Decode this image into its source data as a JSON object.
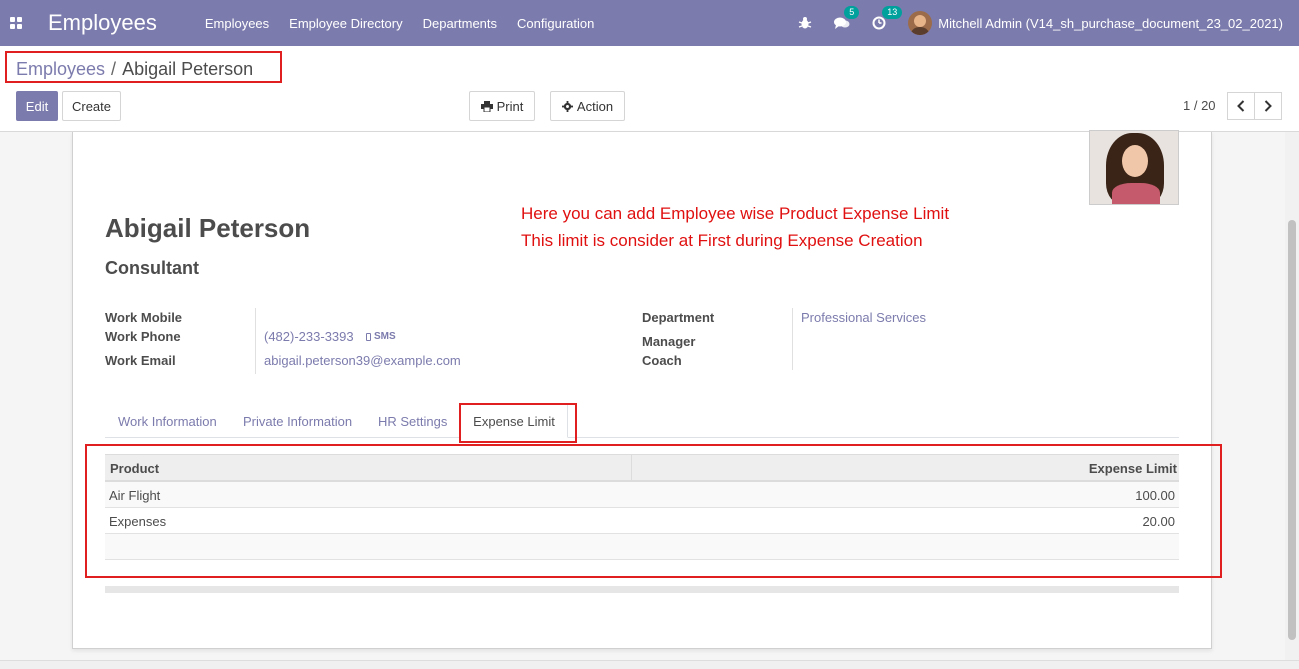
{
  "navbar": {
    "app_title": "Employees",
    "menu": [
      "Employees",
      "Employee Directory",
      "Departments",
      "Configuration"
    ],
    "messages_count": "5",
    "activities_count": "13",
    "user_name": "Mitchell Admin (V14_sh_purchase_document_23_02_2021)"
  },
  "breadcrumb": {
    "parent": "Employees",
    "separator": "/",
    "current": "Abigail Peterson"
  },
  "toolbar": {
    "edit_label": "Edit",
    "create_label": "Create",
    "print_label": "Print",
    "action_label": "Action"
  },
  "pager": {
    "value": "1 / 20"
  },
  "employee": {
    "name": "Abigail Peterson",
    "job_title": "Consultant"
  },
  "annotation": {
    "line1": "Here you can add Employee wise Product Expense Limit",
    "line2": "This limit is consider at First during Expense Creation"
  },
  "fields": {
    "work_mobile_label": "Work Mobile",
    "work_phone_label": "Work Phone",
    "work_phone_value": "(482)-233-3393",
    "sms_label": "SMS",
    "work_email_label": "Work Email",
    "work_email_value": "abigail.peterson39@example.com",
    "department_label": "Department",
    "department_value": "Professional Services",
    "manager_label": "Manager",
    "coach_label": "Coach"
  },
  "tabs": {
    "work_information": "Work Information",
    "private_information": "Private Information",
    "hr_settings": "HR Settings",
    "expense_limit": "Expense Limit"
  },
  "expense_table": {
    "headers": {
      "product": "Product",
      "expense_limit": "Expense Limit"
    },
    "rows": [
      {
        "product": "Air Flight",
        "limit": "100.00"
      },
      {
        "product": "Expenses",
        "limit": "20.00"
      }
    ]
  },
  "colors": {
    "brand": "#7c7bad",
    "annotation": "#e02020"
  }
}
